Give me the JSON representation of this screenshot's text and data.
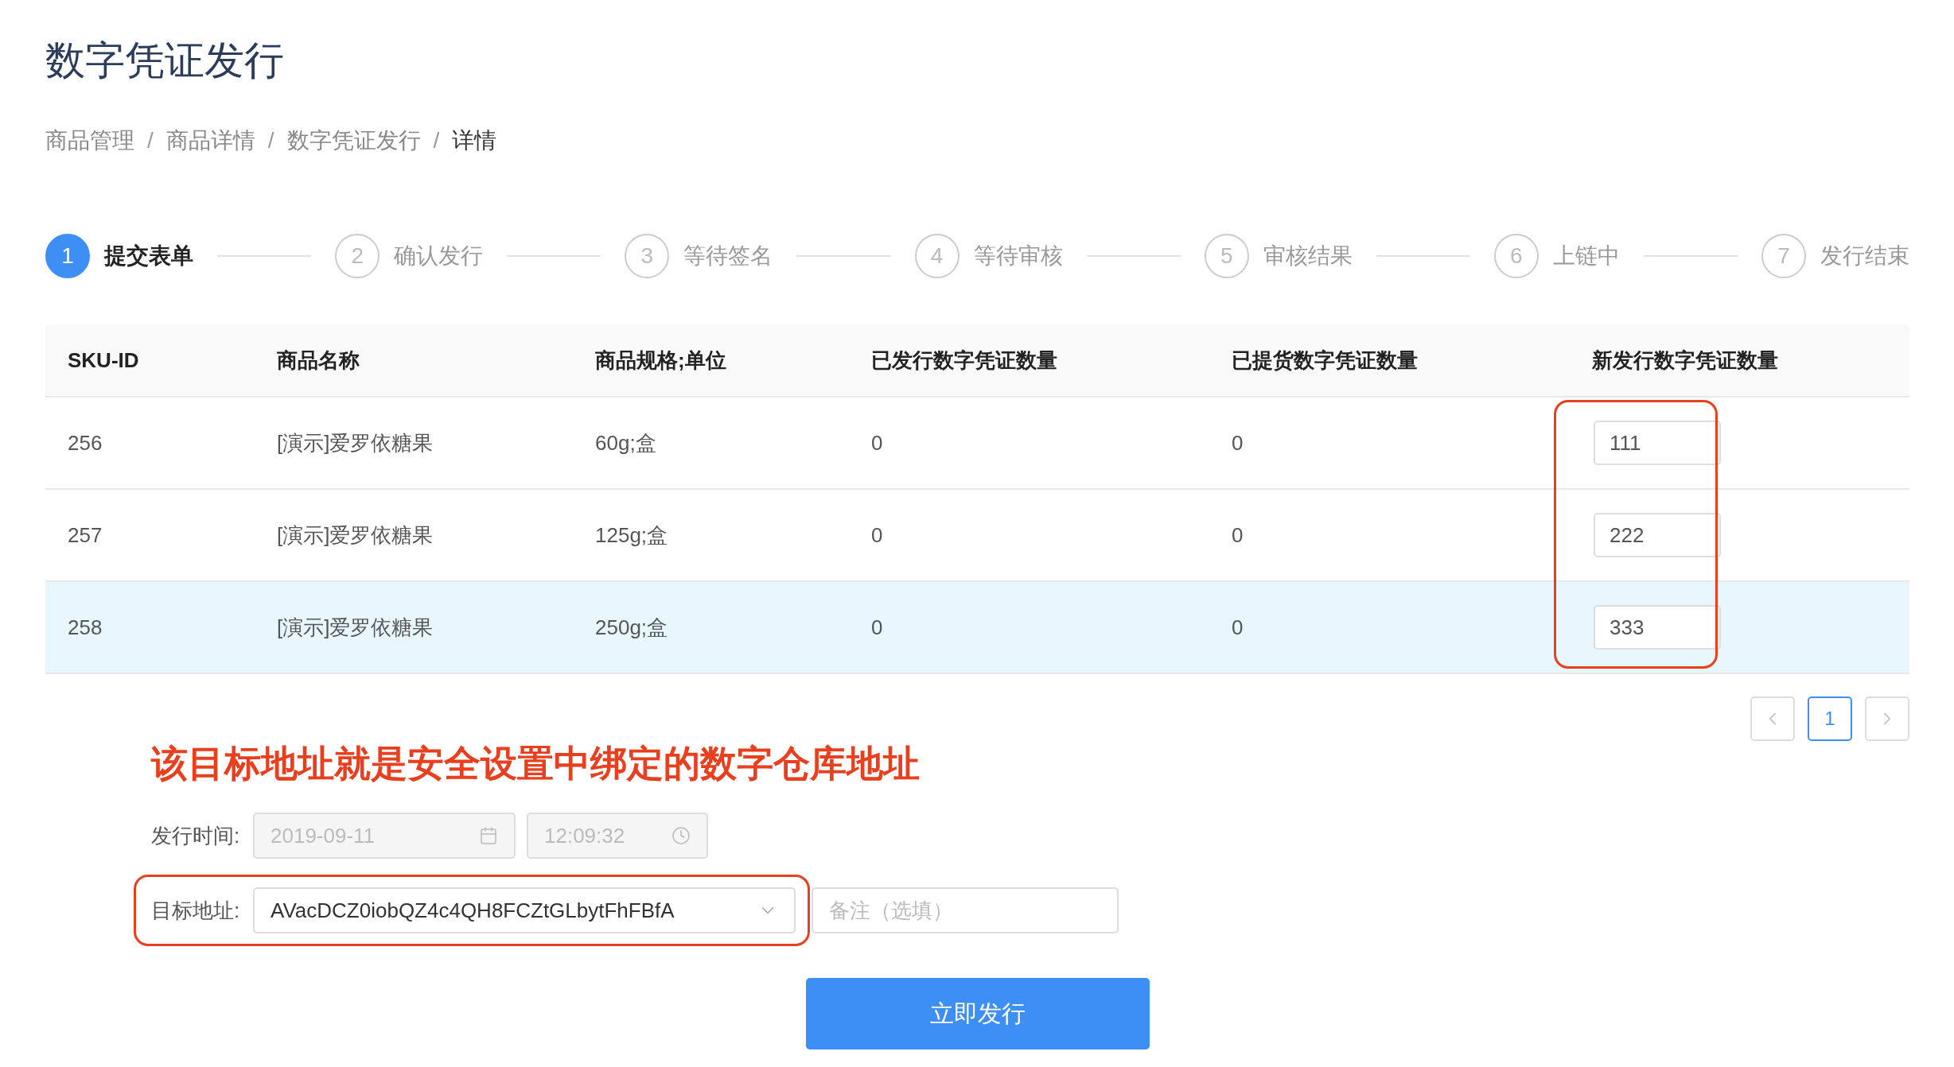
{
  "title": "数字凭证发行",
  "breadcrumb": [
    {
      "label": "商品管理",
      "current": false
    },
    {
      "label": "商品详情",
      "current": false
    },
    {
      "label": "数字凭证发行",
      "current": false
    },
    {
      "label": "详情",
      "current": true
    }
  ],
  "breadcrumb_separator": "/",
  "steps": [
    {
      "number": "1",
      "label": "提交表单",
      "selected": true
    },
    {
      "number": "2",
      "label": "确认发行",
      "selected": false
    },
    {
      "number": "3",
      "label": "等待签名",
      "selected": false
    },
    {
      "number": "4",
      "label": "等待审核",
      "selected": false
    },
    {
      "number": "5",
      "label": "审核结果",
      "selected": false
    },
    {
      "number": "6",
      "label": "上链中",
      "selected": false
    },
    {
      "number": "7",
      "label": "发行结束",
      "selected": false
    }
  ],
  "table": {
    "columns": [
      "SKU-ID",
      "商品名称",
      "商品规格;单位",
      "已发行数字凭证数量",
      "已提货数字凭证数量",
      "新发行数字凭证数量"
    ],
    "rows": [
      {
        "sku_id": "256",
        "name": "[演示]爱罗依糖果",
        "spec": "60g;盒",
        "issued": "0",
        "taken": "0",
        "new_quantity": "111",
        "selected": false
      },
      {
        "sku_id": "257",
        "name": "[演示]爱罗依糖果",
        "spec": "125g;盒",
        "issued": "0",
        "taken": "0",
        "new_quantity": "222",
        "selected": false
      },
      {
        "sku_id": "258",
        "name": "[演示]爱罗依糖果",
        "spec": "250g;盒",
        "issued": "0",
        "taken": "0",
        "new_quantity": "333",
        "selected": true
      }
    ]
  },
  "pagination": {
    "pages": [
      {
        "label": "1",
        "selected": true
      }
    ]
  },
  "annotation": "该目标地址就是安全设置中绑定的数字仓库地址",
  "form": {
    "time_label": "发行时间:",
    "date_value": "2019-09-11",
    "time_value": "12:09:32",
    "time_disabled": true,
    "address_label": "目标地址:",
    "address_value": "AVacDCZ0iobQZ4c4QH8FCZtGLbytFhFBfA",
    "note_placeholder": "备注（选填）"
  },
  "submit_button": "立即发行"
}
